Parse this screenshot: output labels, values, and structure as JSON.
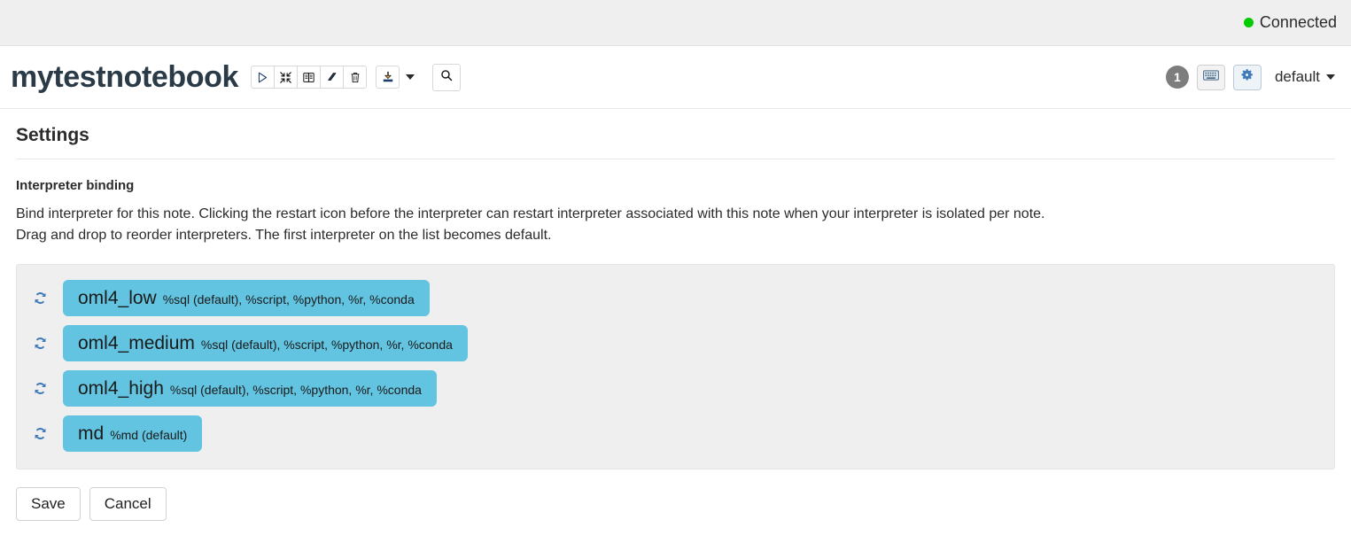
{
  "status_bar": {
    "connection_label": "Connected",
    "connection_color": "#00cc00"
  },
  "note_header": {
    "title": "mytestnotebook",
    "toolbar": [
      {
        "name": "run-all-paragraphs-button",
        "icon": "play-icon",
        "tooltip": "Run all paragraphs"
      },
      {
        "name": "collapse-all-button",
        "icon": "collapse-icon",
        "tooltip": "Show/hide the code"
      },
      {
        "name": "toggle-output-button",
        "icon": "book-icon",
        "tooltip": "Show/hide the output"
      },
      {
        "name": "clear-output-button",
        "icon": "eraser-icon",
        "tooltip": "Clear output"
      },
      {
        "name": "delete-note-button",
        "icon": "trash-icon",
        "tooltip": "Remove the notebook"
      }
    ],
    "export_button": {
      "name": "export-note-button",
      "icon": "download-icon"
    },
    "export_caret": {
      "name": "export-dropdown-caret",
      "icon": "chevron-down-icon"
    },
    "search_button": {
      "name": "search-code-button",
      "icon": "search-icon"
    },
    "revision_count": "1",
    "keyboard_button": {
      "name": "keyboard-shortcuts-button",
      "icon": "keyboard-icon"
    },
    "settings_button": {
      "name": "interpreter-settings-button",
      "icon": "gear-icon"
    },
    "permissions_dropdown": {
      "label": "default",
      "icon": "chevron-down-icon"
    }
  },
  "settings": {
    "heading": "Settings",
    "section_title": "Interpreter binding",
    "description_line1": "Bind interpreter for this note. Clicking the restart icon before the interpreter can restart interpreter associated with this note when your interpreter is isolated per note.",
    "description_line2": "Drag and drop to reorder interpreters. The first interpreter on the list becomes default.",
    "chip_color": "#62c4e0",
    "interpreters": [
      {
        "name": "oml4_low",
        "modes": "%sql (default), %script, %python, %r, %conda",
        "restart_icon": "restart-icon"
      },
      {
        "name": "oml4_medium",
        "modes": "%sql (default), %script, %python, %r, %conda",
        "restart_icon": "restart-icon"
      },
      {
        "name": "oml4_high",
        "modes": "%sql (default), %script, %python, %r, %conda",
        "restart_icon": "restart-icon"
      },
      {
        "name": "md",
        "modes": "%md (default)",
        "restart_icon": "restart-icon"
      }
    ],
    "save_label": "Save",
    "cancel_label": "Cancel"
  }
}
